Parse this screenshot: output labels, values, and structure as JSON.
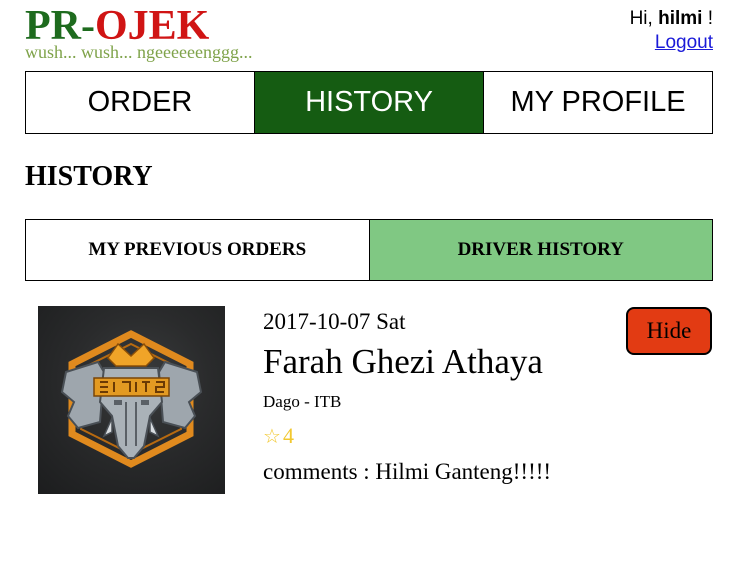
{
  "brand": {
    "logo_pr": "PR",
    "logo_dash": "-",
    "logo_ojek": "OJEK",
    "tagline": "wush... wush... ngeeeeeenggg..."
  },
  "user": {
    "greeting": "Hi,",
    "username": "hilmi",
    "exclaim": "!",
    "logout_label": "Logout"
  },
  "nav": {
    "tabs": [
      {
        "label": "ORDER",
        "active": false
      },
      {
        "label": "HISTORY",
        "active": true
      },
      {
        "label": "MY PROFILE",
        "active": false
      }
    ]
  },
  "page": {
    "title": "HISTORY"
  },
  "subnav": {
    "tabs": [
      {
        "label": "MY PREVIOUS ORDERS",
        "active": false
      },
      {
        "label": "DRIVER HISTORY",
        "active": true
      }
    ]
  },
  "history": {
    "items": [
      {
        "avatar_icon": "elephant-emblem-icon",
        "date": "2017-10-07 Sat",
        "name": "Farah Ghezi Athaya",
        "route": "Dago - ITB",
        "rating_icon": "star-outline-icon",
        "rating": "4",
        "comment": "comments : Hilmi Ganteng!!!!!",
        "hide_label": "Hide"
      }
    ]
  },
  "colors": {
    "nav_active_bg": "#155c12",
    "subnav_active_bg": "#80c883",
    "hide_button_bg": "#e23b13",
    "logo_green": "#1e6b1e",
    "logo_red": "#d01414",
    "tagline": "#7fa34a",
    "rating_star": "#f2c830"
  }
}
